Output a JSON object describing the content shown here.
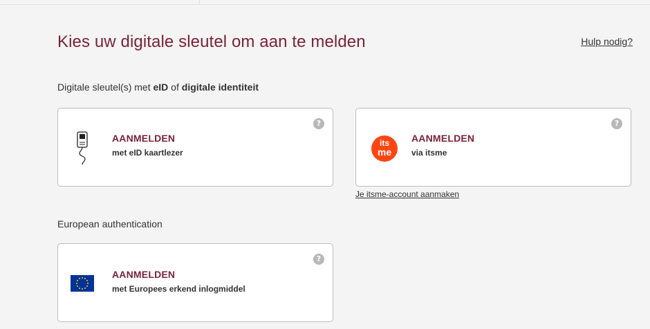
{
  "page": {
    "title": "Kies uw digitale sleutel om aan te melden",
    "help_link": "Hulp nodig?"
  },
  "section_eid": {
    "prefix": "Digitale sleutel(s) met ",
    "bold1": "eID",
    "middle": " of ",
    "bold2": "digitale identiteit"
  },
  "cards": {
    "eid": {
      "title": "AANMELDEN",
      "subtitle": "met eID kaartlezer",
      "icon": "card-reader-icon"
    },
    "itsme": {
      "title": "AANMELDEN",
      "subtitle": "via itsme",
      "icon": "itsme-logo",
      "logo_text_top": "its",
      "logo_text_bottom": "me",
      "brand_color": "#ff4612"
    },
    "europe": {
      "title": "AANMELDEN",
      "subtitle": "met Europees erkend inlogmiddel",
      "icon": "eu-flag-icon"
    }
  },
  "help_glyph": "?",
  "itsme_link": "Je itsme-account aanmaken",
  "section_european": {
    "label": "European authentication"
  },
  "colors": {
    "accent": "#7a2239",
    "background": "#f4f4f4",
    "eu_blue": "#003399",
    "eu_star": "#ffcc00"
  }
}
